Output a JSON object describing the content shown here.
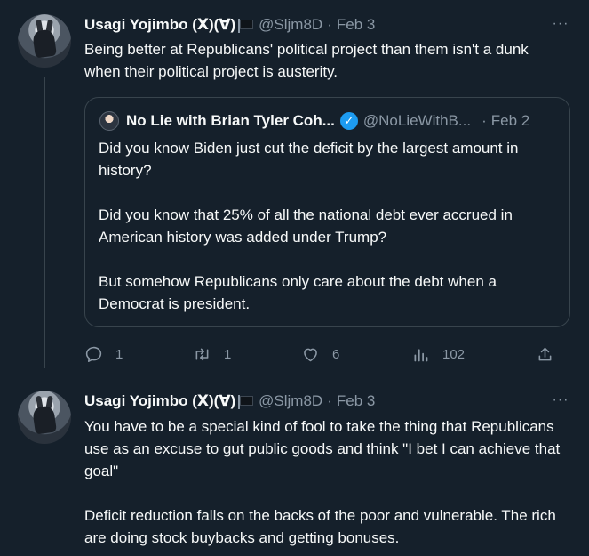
{
  "tweets": [
    {
      "author_name": "Usagi Yojimbo (ꓫ)(∀)",
      "handle": "@Sljm8D",
      "separator": "·",
      "date": "Feb 3",
      "more": "···",
      "text": "Being better at Republicans' political project than them isn't a dunk when their political project is austerity.",
      "quote": {
        "author_name": "No Lie with Brian Tyler Coh...",
        "verified_mark": "✓",
        "handle": "@NoLieWithB...",
        "separator": "·",
        "date": "Feb 2",
        "text": "Did you know Biden just cut the deficit by the largest amount in history?\n\nDid you know that 25% of all the national debt ever accrued in American history was added under Trump?\n\nBut somehow Republicans only care about the debt when a Democrat is president."
      },
      "actions": {
        "replies": "1",
        "retweets": "1",
        "likes": "6",
        "views": "102"
      }
    },
    {
      "author_name": "Usagi Yojimbo (ꓫ)(∀)",
      "handle": "@Sljm8D",
      "separator": "·",
      "date": "Feb 3",
      "more": "···",
      "text": "You have to be a special kind of fool to take the thing that Republicans use as an excuse to gut public goods and think \"I bet I can achieve that goal\"\n\nDeficit reduction falls on the backs of the poor and vulnerable. The rich are doing stock buybacks and getting bonuses."
    }
  ],
  "icons": {
    "reply": "reply-icon",
    "retweet": "retweet-icon",
    "like": "heart-icon",
    "views": "views-icon",
    "share": "share-icon",
    "flag": "black-flag-icon"
  },
  "colors": {
    "background": "#15202b",
    "text": "#f7f9f9",
    "secondary": "#8b98a5",
    "border": "#38444d",
    "verified": "#1d9bf0"
  }
}
